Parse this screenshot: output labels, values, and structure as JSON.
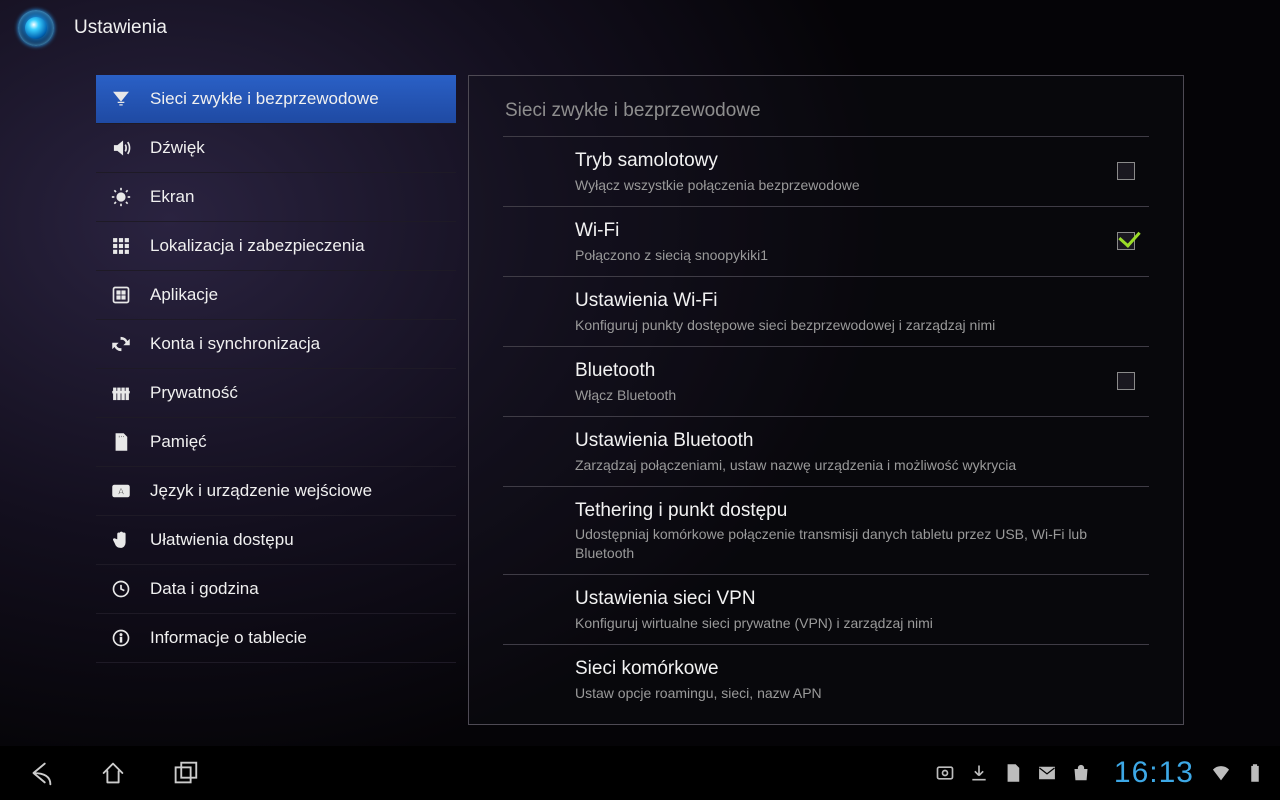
{
  "app": {
    "title": "Ustawienia"
  },
  "sidebar": {
    "items": [
      {
        "label": "Sieci zwykłe i bezprzewodowe",
        "icon": "signal-bars-icon",
        "selected": true
      },
      {
        "label": "Dźwięk",
        "icon": "speaker-icon"
      },
      {
        "label": "Ekran",
        "icon": "brightness-icon"
      },
      {
        "label": "Lokalizacja i zabezpieczenia",
        "icon": "grid-icon"
      },
      {
        "label": "Aplikacje",
        "icon": "apps-icon"
      },
      {
        "label": "Konta i synchronizacja",
        "icon": "sync-icon"
      },
      {
        "label": "Prywatność",
        "icon": "fence-icon"
      },
      {
        "label": "Pamięć",
        "icon": "sdcard-icon"
      },
      {
        "label": "Język i urządzenie wejściowe",
        "icon": "keyboard-a-icon"
      },
      {
        "label": "Ułatwienia dostępu",
        "icon": "hand-icon"
      },
      {
        "label": "Data i godzina",
        "icon": "clock-icon"
      },
      {
        "label": "Informacje o tablecie",
        "icon": "info-icon"
      }
    ]
  },
  "panel": {
    "header": "Sieci zwykłe i bezprzewodowe",
    "rows": [
      {
        "title": "Tryb samolotowy",
        "subtitle": "Wyłącz wszystkie połączenia bezprzewodowe",
        "checkbox": true,
        "checked": false
      },
      {
        "title": "Wi-Fi",
        "subtitle": "Połączono z siecią snoopykiki1",
        "checkbox": true,
        "checked": true
      },
      {
        "title": "Ustawienia Wi-Fi",
        "subtitle": "Konfiguruj punkty dostępowe sieci bezprzewodowej i zarządzaj nimi",
        "checkbox": false
      },
      {
        "title": "Bluetooth",
        "subtitle": "Włącz Bluetooth",
        "checkbox": true,
        "checked": false
      },
      {
        "title": "Ustawienia Bluetooth",
        "subtitle": "Zarządzaj połączeniami, ustaw nazwę urządzenia i możliwość wykrycia",
        "checkbox": false
      },
      {
        "title": "Tethering i punkt dostępu",
        "subtitle": "Udostępniaj komórkowe połączenie transmisji danych tabletu przez USB, Wi-Fi lub Bluetooth",
        "checkbox": false
      },
      {
        "title": "Ustawienia sieci VPN",
        "subtitle": "Konfiguruj wirtualne sieci prywatne (VPN) i zarządzaj nimi",
        "checkbox": false
      },
      {
        "title": "Sieci komórkowe",
        "subtitle": "Ustaw opcje roamingu, sieci, nazw APN",
        "checkbox": false
      }
    ]
  },
  "sysbar": {
    "clock": "16:13"
  }
}
